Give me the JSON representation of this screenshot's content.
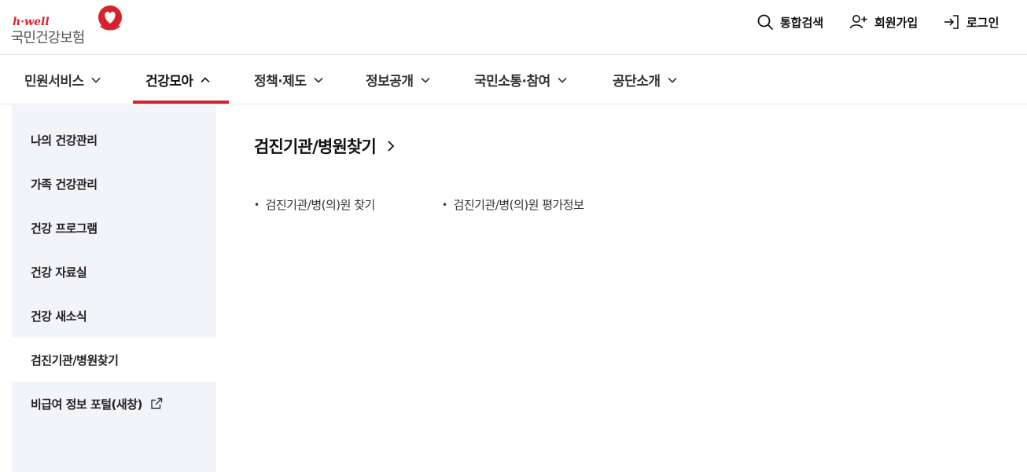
{
  "brand": {
    "tagline": "h·well",
    "name": "국민건강보험",
    "accent_color": "#d7222c"
  },
  "utility": {
    "search": {
      "label": "통합검색",
      "icon": "search-icon"
    },
    "join": {
      "label": "회원가입",
      "icon": "user-add-icon"
    },
    "login": {
      "label": "로그인",
      "icon": "login-icon"
    }
  },
  "gnb": {
    "items": [
      {
        "label": "민원서비스",
        "expanded": false
      },
      {
        "label": "건강모아",
        "expanded": true
      },
      {
        "label": "정책·제도",
        "expanded": false
      },
      {
        "label": "정보공개",
        "expanded": false
      },
      {
        "label": "국민소통·참여",
        "expanded": false
      },
      {
        "label": "공단소개",
        "expanded": false
      }
    ]
  },
  "sidebar": {
    "items": [
      {
        "label": "나의 건강관리"
      },
      {
        "label": "가족 건강관리"
      },
      {
        "label": "건강 프로그램"
      },
      {
        "label": "건강 자료실"
      },
      {
        "label": "건강 새소식"
      },
      {
        "label": "검진기관/병원찾기",
        "active": true
      },
      {
        "label": "비급여 정보 포털(새창)",
        "icon": "external-link-icon"
      }
    ]
  },
  "main": {
    "title": "검진기관/병원찾기",
    "links": [
      {
        "label": "검진기관/병(의)원 찾기"
      },
      {
        "label": "검진기관/병(의)원 평가정보"
      }
    ]
  }
}
